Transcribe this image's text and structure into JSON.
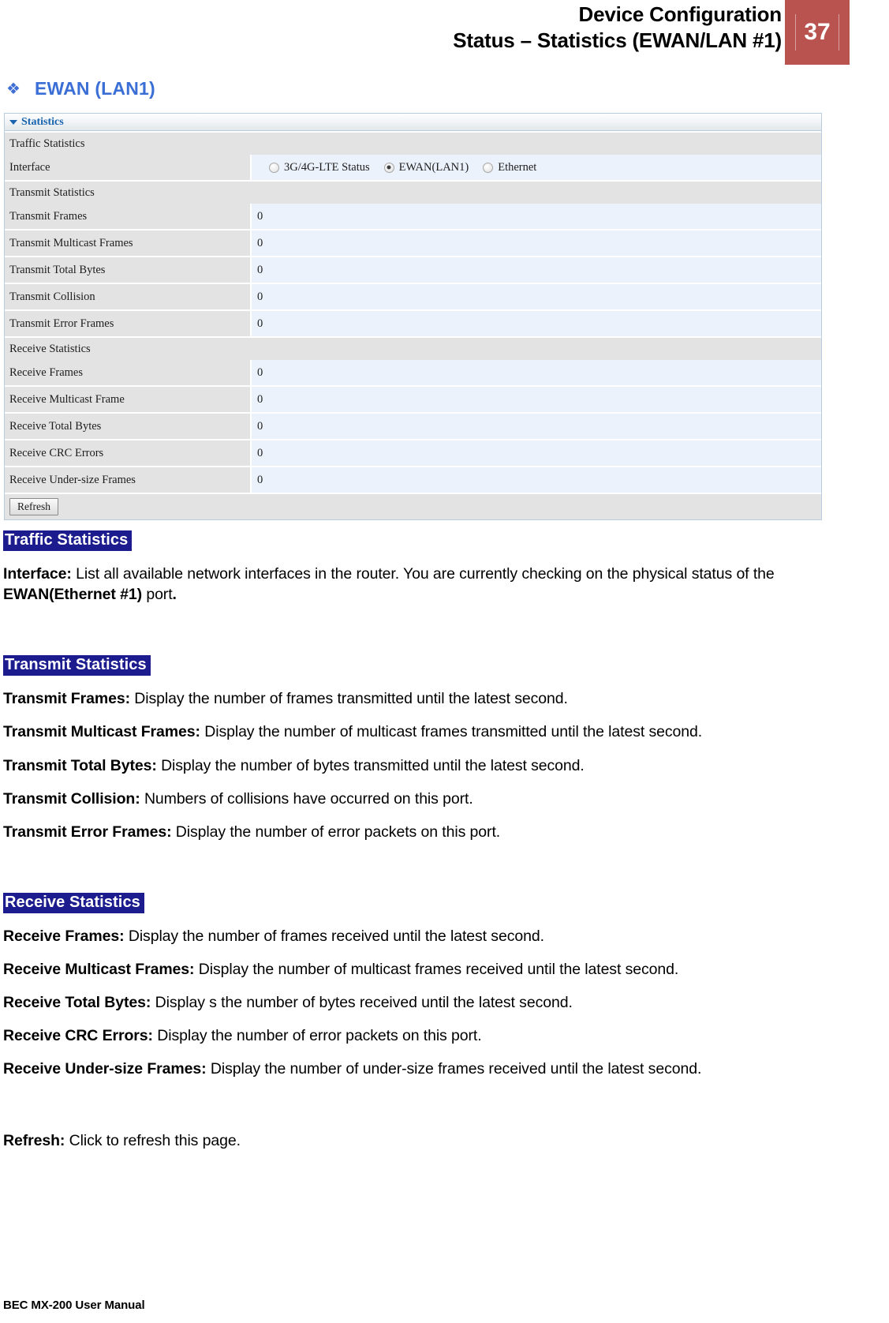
{
  "header": {
    "title_line1": "Device Configuration",
    "title_line2": "Status – Statistics (EWAN/LAN #1)",
    "page_number": "37",
    "badge_color": "#b9534f"
  },
  "section_heading": {
    "bullet_glyph": "❖",
    "text": "EWAN (LAN1)",
    "color": "#3b6fd6"
  },
  "panel": {
    "title": "Statistics",
    "title_color": "#1763ad",
    "traffic_section_label": "Traffic Statistics",
    "interface_row": {
      "label": "Interface",
      "options": [
        {
          "label": "3G/4G-LTE Status",
          "checked": false
        },
        {
          "label": "EWAN(LAN1)",
          "checked": true
        },
        {
          "label": "Ethernet",
          "checked": false
        }
      ]
    },
    "transmit_section_label": "Transmit Statistics",
    "transmit_rows": [
      {
        "label": "Transmit Frames",
        "value": "0"
      },
      {
        "label": "Transmit Multicast Frames",
        "value": "0"
      },
      {
        "label": "Transmit Total Bytes",
        "value": "0"
      },
      {
        "label": "Transmit Collision",
        "value": "0"
      },
      {
        "label": "Transmit Error Frames",
        "value": "0"
      }
    ],
    "receive_section_label": "Receive Statistics",
    "receive_rows": [
      {
        "label": "Receive Frames",
        "value": "0"
      },
      {
        "label": "Receive Multicast Frame",
        "value": "0"
      },
      {
        "label": "Receive Total Bytes",
        "value": "0"
      },
      {
        "label": "Receive CRC Errors",
        "value": "0"
      },
      {
        "label": "Receive Under-size Frames",
        "value": "0"
      }
    ],
    "refresh_button": "Refresh"
  },
  "body": {
    "traffic_heading": "Traffic Statistics",
    "interface_term": "Interface:",
    "interface_desc_a": " List all available network interfaces in the router.  You are currently checking on the physical status of the ",
    "interface_bold_b": "EWAN(Ethernet #1)",
    "interface_desc_c": " port",
    "interface_desc_d": ".",
    "transmit_heading": "Transmit Statistics",
    "transmit_items": [
      {
        "term": "Transmit Frames:",
        "desc": " Display the number of frames transmitted until the latest second."
      },
      {
        "term": "Transmit Multicast Frames:",
        "desc": " Display the number of multicast frames transmitted until the latest second."
      },
      {
        "term": "Transmit Total Bytes:",
        "desc": " Display the number of bytes transmitted until the latest second."
      },
      {
        "term": "Transmit Collision:",
        "desc": " Numbers of collisions have occurred on this port."
      },
      {
        "term": "Transmit Error Frames:",
        "desc": " Display the number of error packets on this port."
      }
    ],
    "receive_heading": "Receive Statistics",
    "receive_items": [
      {
        "term": "Receive Frames:",
        "desc": " Display the number of frames received until the latest second."
      },
      {
        "term": "Receive Multicast Frames:",
        "desc": " Display the number of multicast frames received until the latest second."
      },
      {
        "term": "Receive Total Bytes:",
        "desc": " Display s the number of bytes received until the latest second."
      },
      {
        "term": "Receive CRC Errors:",
        "desc": " Display the number of error packets on this port."
      },
      {
        "term": "Receive Under-size Frames:",
        "desc": " Display the number of under-size frames received until the latest second."
      }
    ],
    "refresh_item": {
      "term": "Refresh:",
      "desc": " Click to refresh this page."
    }
  },
  "footer": {
    "text": "BEC MX-200 User Manual"
  }
}
